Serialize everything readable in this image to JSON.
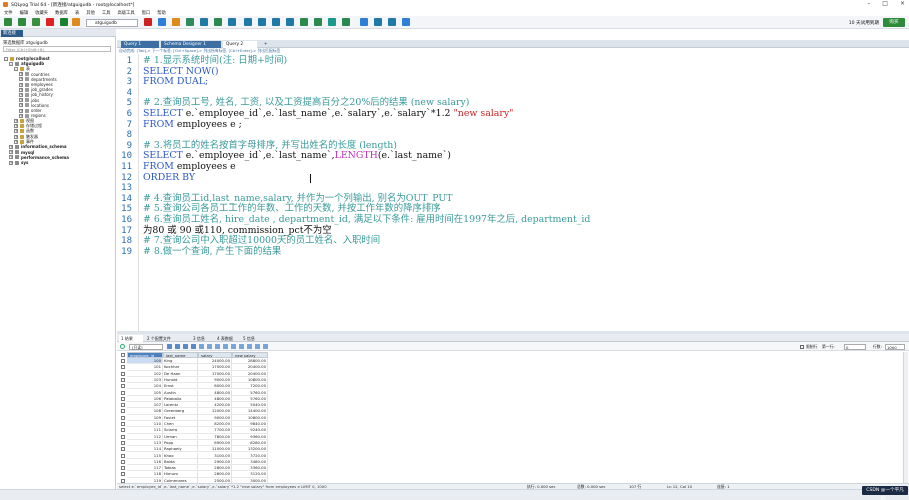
{
  "title": "SQLyog Trial 64 - [新连接/atguigudb - root@localhost*]",
  "menu": [
    "文件",
    "编辑",
    "收藏夹",
    "数据库",
    "表",
    "其他",
    "工具",
    "高级工具",
    "窗口",
    "帮助"
  ],
  "toolbar": {
    "db": "atguigudb",
    "trial_text": "10 天试用到期",
    "buy_label": "购买"
  },
  "left": {
    "tab": "新连接",
    "filter_label": "筛选数据库  atguigudb",
    "filter_placeholder": "Filter (Ctrl+Shift+B)",
    "tree": [
      {
        "label": "root@localhost",
        "indent": 0,
        "exp": "-"
      },
      {
        "label": "atguigudb",
        "indent": 1,
        "exp": "-"
      },
      {
        "label": "表",
        "indent": 2,
        "exp": "-"
      },
      {
        "label": "countries",
        "indent": 3,
        "exp": "+"
      },
      {
        "label": "departments",
        "indent": 3,
        "exp": "+"
      },
      {
        "label": "employees",
        "indent": 3,
        "exp": "+"
      },
      {
        "label": "job_grades",
        "indent": 3,
        "exp": "+"
      },
      {
        "label": "job_history",
        "indent": 3,
        "exp": "+"
      },
      {
        "label": "jobs",
        "indent": 3,
        "exp": "+"
      },
      {
        "label": "locations",
        "indent": 3,
        "exp": "+"
      },
      {
        "label": "order",
        "indent": 3,
        "exp": "+"
      },
      {
        "label": "regions",
        "indent": 3,
        "exp": "+"
      },
      {
        "label": "视图",
        "indent": 2,
        "exp": "+"
      },
      {
        "label": "存储过程",
        "indent": 2,
        "exp": "+"
      },
      {
        "label": "函数",
        "indent": 2,
        "exp": "+"
      },
      {
        "label": "触发器",
        "indent": 2,
        "exp": "+"
      },
      {
        "label": "事件",
        "indent": 2,
        "exp": "+"
      },
      {
        "label": "information_schema",
        "indent": 1,
        "exp": "+"
      },
      {
        "label": "mysql",
        "indent": 1,
        "exp": "+"
      },
      {
        "label": "performance_schema",
        "indent": 1,
        "exp": "+"
      },
      {
        "label": "sys",
        "indent": 1,
        "exp": "+"
      }
    ]
  },
  "query_tabs": [
    "Query 1",
    "Schema Designer 1",
    "Query 2"
  ],
  "breadcrumb": "自动完成: [Tab]-> 下一个标签, [Ctrl+Space]-> 列出所有标签, [Ctrl+Enter]-> 列出匹配标签",
  "editor": {
    "lines": [
      [
        [
          "cm",
          "# 1.显示系统时间(注: 日期+时间)"
        ]
      ],
      [
        [
          "kw",
          "SELECT NOW()"
        ]
      ],
      [
        [
          "kw",
          "FROM DUAL;"
        ]
      ],
      [],
      [
        [
          "cm",
          "# 2.查询员工号, 姓名, 工资, 以及工资提高百分之20%后的结果 (new salary)"
        ]
      ],
      [
        [
          "kw",
          "SELECT "
        ],
        [
          "tx",
          "e.`employee_id`,e.`last_name`,e.`salary`,e.`salary`*1.2 "
        ],
        [
          "st",
          "\"new salary\""
        ]
      ],
      [
        [
          "kw",
          "FROM "
        ],
        [
          "tx",
          "employees e ;"
        ]
      ],
      [],
      [
        [
          "cm",
          "# 3.将员工的姓名按首字母排序, 并写出姓名的长度 (length)"
        ]
      ],
      [
        [
          "kw",
          "SELECT "
        ],
        [
          "tx",
          "e.`employee_id`,e.`last_name`,"
        ],
        [
          "fn",
          "LENGTH"
        ],
        [
          "tx",
          "(e.`last_name`)"
        ]
      ],
      [
        [
          "kw",
          "FROM "
        ],
        [
          "tx",
          "employees e"
        ]
      ],
      [
        [
          "kw",
          "ORDER BY "
        ]
      ],
      [],
      [
        [
          "cm",
          "# 4.查询员工id,last_name,salary, 并作为一个列输出, 别名为OUT_PUT"
        ]
      ],
      [
        [
          "cm",
          "# 5.查询公司各员工工作的年数、工作的天数, 并按工作年数的降序排序"
        ]
      ],
      [
        [
          "cm",
          "# 6.查询员工姓名, hire_date , department_id, 满足以下条件: 雇用时间在1997年之后, department_id"
        ]
      ],
      [
        [
          "tx",
          "为80 或 90 或110, commission_pct不为空"
        ]
      ],
      [
        [
          "cm",
          "# 7.查询公司中入职超过10000天的员工姓名、入职时间"
        ]
      ],
      [
        [
          "cm",
          "# 8.做一个查询, 产生下面的结果"
        ]
      ]
    ]
  },
  "result_tabs": [
    "1 结果",
    "2 个配置文件",
    "3 信息",
    "4 表数据",
    "5 信息"
  ],
  "result_toolbar": {
    "mode": "(只读)",
    "limit_label": "限制行",
    "first_row": "第一行:",
    "first_val": "0",
    "rows_label": "行数:",
    "rows_val": "1000"
  },
  "grid": {
    "columns": [
      "employee_id",
      "last_name",
      "salary",
      "new salary"
    ],
    "rows": [
      [
        "100",
        "King",
        "24000.00",
        "28800.00"
      ],
      [
        "101",
        "Kochhar",
        "17000.00",
        "20400.00"
      ],
      [
        "102",
        "De Haan",
        "17000.00",
        "20400.00"
      ],
      [
        "103",
        "Hunold",
        "9000.00",
        "10800.00"
      ],
      [
        "104",
        "Ernst",
        "6000.00",
        "7200.00"
      ],
      [
        "105",
        "Austin",
        "4800.00",
        "5760.00"
      ],
      [
        "106",
        "Pataballa",
        "4800.00",
        "5760.00"
      ],
      [
        "107",
        "Lorentz",
        "4200.00",
        "5040.00"
      ],
      [
        "108",
        "Greenberg",
        "12000.00",
        "14400.00"
      ],
      [
        "109",
        "Faviet",
        "9000.00",
        "10800.00"
      ],
      [
        "110",
        "Chen",
        "8200.00",
        "9840.00"
      ],
      [
        "111",
        "Sciarra",
        "7700.00",
        "9240.00"
      ],
      [
        "112",
        "Urman",
        "7800.00",
        "9360.00"
      ],
      [
        "113",
        "Popp",
        "6900.00",
        "8280.00"
      ],
      [
        "114",
        "Raphaely",
        "11000.00",
        "13200.00"
      ],
      [
        "115",
        "Khoo",
        "3100.00",
        "3720.00"
      ],
      [
        "116",
        "Baida",
        "2900.00",
        "3480.00"
      ],
      [
        "117",
        "Tobias",
        "2800.00",
        "3360.00"
      ],
      [
        "118",
        "Himuro",
        "2600.00",
        "3120.00"
      ],
      [
        "119",
        "Colmenares",
        "2500.00",
        "3000.00"
      ],
      [
        "120",
        "Weiss",
        "8000.00",
        "9600.00"
      ],
      [
        "121",
        "Fripp",
        "8200.00",
        "9840.00"
      ],
      [
        "122",
        "Kaufling",
        "7900.00",
        "9480.00"
      ],
      [
        "123",
        "Vollman",
        "6500.00",
        "7800.00"
      ]
    ]
  },
  "status": {
    "query": "select e.`employee_id`,e.`last_name`,e.`salary`,e.`salary`*1.2 \"new salary\" from employees e LIMIT 0, 1000",
    "exec": "执行: 0.000 sec",
    "total": "总数: 0.000 sec",
    "rows": "107 行",
    "pos": "Ln 12, Col 10",
    "conn": "连接: 1"
  },
  "watermark": "CSDN @一个平凡的..."
}
